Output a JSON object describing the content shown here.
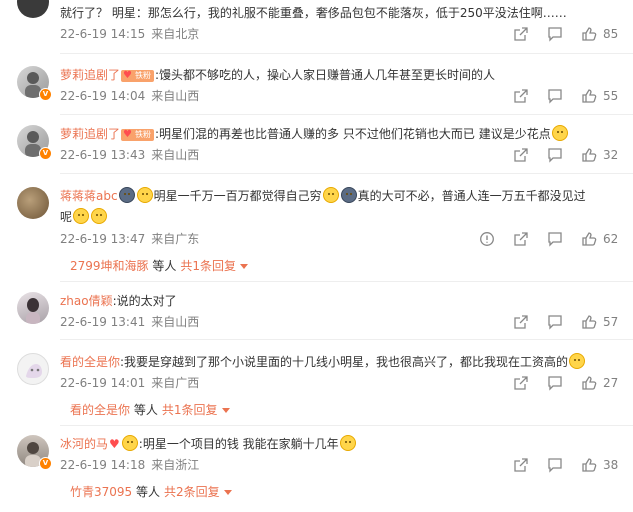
{
  "comments": [
    {
      "username": "",
      "text": "就行了？ 明星：那怎么行，我的礼服不能重叠，奢侈品包包不能落灰，低于250平没法住啊……",
      "time": "22-6-19 14:15",
      "location": "来自北京",
      "likes": "85"
    },
    {
      "username": "萝莉追剧了",
      "fan_badge": "铁粉",
      "text": ":馒头都不够吃的人，操心人家日赚普通人几年甚至更长时间的人",
      "time": "22-6-19 14:04",
      "location": "来自山西",
      "likes": "55"
    },
    {
      "username": "萝莉追剧了",
      "fan_badge": "铁粉",
      "text": ":明星们混的再差也比普通人赚的多 只不过他们花销也大而已 建议是少花点",
      "time": "22-6-19 13:43",
      "location": "来自山西",
      "likes": "32"
    },
    {
      "username": "蒋蒋蒋abc",
      "text_part1": "明星一千万一百万都觉得自己穷",
      "text_part2": "真的大可不必，普通人连一万五千都没见过",
      "text_part3": "呢",
      "time": "22-6-19 13:47",
      "location": "来自广东",
      "likes": "62",
      "reply_user": "2799坤和海豚",
      "reply_mid": "等人",
      "reply_count": "共1条回复"
    },
    {
      "username": "zhao倩颖",
      "text": ":说的太对了",
      "time": "22-6-19 13:41",
      "location": "来自山西",
      "likes": "57"
    },
    {
      "username": "看的全是你",
      "text": ":我要是穿越到了那个小说里面的十几线小明星，我也很高兴了，都比我现在工资高的",
      "time": "22-6-19 14:01",
      "location": "来自广西",
      "likes": "27",
      "reply_user": "看的全是你",
      "reply_mid": "等人",
      "reply_count": "共1条回复"
    },
    {
      "username": "冰河的马",
      "text": ":明星一个项目的钱 我能在家躺十几年",
      "time": "22-6-19 14:18",
      "location": "来自浙江",
      "likes": "38",
      "reply_user": "竹青37095",
      "reply_mid": "等人",
      "reply_count": "共2条回复"
    }
  ]
}
